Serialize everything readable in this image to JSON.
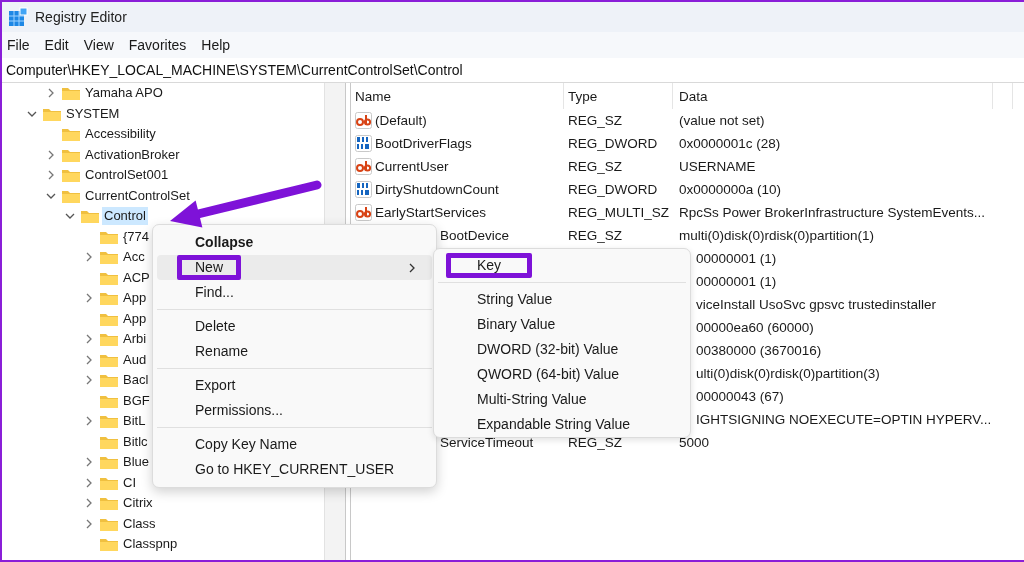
{
  "window": {
    "title": "Registry Editor"
  },
  "menu_bar": [
    "File",
    "Edit",
    "View",
    "Favorites",
    "Help"
  ],
  "address_bar": {
    "value": "Computer\\HKEY_LOCAL_MACHINE\\SYSTEM\\CurrentControlSet\\Control"
  },
  "tree": {
    "tail_of_previous_key": [
      {
        "label": "Yamaha APO",
        "expanded": false,
        "selected": false
      }
    ],
    "keys": [
      {
        "label": "SYSTEM",
        "expanded": true,
        "selected": false,
        "children": [
          {
            "label": "Accessibility",
            "selected": false
          },
          {
            "label": "ActivationBroker",
            "expanded": false,
            "selected": false
          },
          {
            "label": "ControlSet001",
            "expanded": false,
            "selected": false
          },
          {
            "label": "CurrentControlSet",
            "expanded": true,
            "selected": false,
            "children": [
              {
                "label": "Control",
                "expanded": true,
                "selected": true,
                "children": [
                  {
                    "label": "{774",
                    "selected": false
                  },
                  {
                    "label": "Acc",
                    "expanded": false,
                    "selected": false
                  },
                  {
                    "label": "ACP",
                    "selected": false
                  },
                  {
                    "label": "App",
                    "expanded": false,
                    "selected": false
                  },
                  {
                    "label": "App",
                    "selected": false
                  },
                  {
                    "label": "Arbi",
                    "expanded": false,
                    "selected": false
                  },
                  {
                    "label": "Aud",
                    "expanded": false,
                    "selected": false
                  },
                  {
                    "label": "Bacl",
                    "expanded": false,
                    "selected": false
                  },
                  {
                    "label": "BGF",
                    "selected": false
                  },
                  {
                    "label": "BitL",
                    "expanded": false,
                    "selected": false
                  },
                  {
                    "label": "Bitlc",
                    "selected": false
                  },
                  {
                    "label": "Blue",
                    "expanded": false,
                    "selected": false
                  },
                  {
                    "label": "CI",
                    "expanded": false,
                    "selected": false
                  },
                  {
                    "label": "Citrix",
                    "expanded": false,
                    "selected": false
                  },
                  {
                    "label": "Class",
                    "expanded": false,
                    "selected": false
                  },
                  {
                    "label": "Classpnp",
                    "selected": false
                  }
                ]
              }
            ]
          }
        ]
      }
    ]
  },
  "values": {
    "columns": [
      "Name",
      "Type",
      "Data"
    ],
    "rows": [
      {
        "kind": "string",
        "name": "(Default)",
        "type": "REG_SZ",
        "data": "(value not set)"
      },
      {
        "kind": "binary",
        "name": "BootDriverFlags",
        "type": "REG_DWORD",
        "data": "0x0000001c (28)"
      },
      {
        "kind": "string",
        "name": "CurrentUser",
        "type": "REG_SZ",
        "data": "USERNAME"
      },
      {
        "kind": "binary",
        "name": "DirtyShutdownCount",
        "type": "REG_DWORD",
        "data": "0x0000000a (10)"
      },
      {
        "kind": "string",
        "name": "EarlyStartServices",
        "type": "REG_MULTI_SZ",
        "data": "RpcSs Power BrokerInfrastructure SystemEvents..."
      },
      {
        "name": "BootDevice",
        "name_cut": true,
        "type": "REG_SZ",
        "data": "multi(0)disk(0)rdisk(0)partition(1)"
      },
      {
        "data": "00000001 (1)",
        "data_cut": true
      },
      {
        "data": "00000001 (1)",
        "data_cut": true
      },
      {
        "data": "viceInstall UsoSvc gpsvc trustedinstaller",
        "data_cut": true
      },
      {
        "data": "00000ea60 (60000)",
        "data_cut": true
      },
      {
        "data": "00380000 (3670016)",
        "data_cut": true
      },
      {
        "data": "ulti(0)disk(0)rdisk(0)partition(3)",
        "data_cut": true
      },
      {
        "data": "00000043 (67)",
        "data_cut": true
      },
      {
        "data": "IGHTSIGNING  NOEXECUTE=OPTIN  HYPERV...",
        "data_cut": true
      },
      {
        "name": "ServiceTimeout",
        "name_cut": true,
        "type": "REG_SZ",
        "data": "5000"
      }
    ]
  },
  "context_menu": {
    "groups": [
      [
        {
          "label": "Collapse",
          "default": true,
          "highlighted": false,
          "annotated": false,
          "submenu": false
        },
        {
          "label": "New",
          "default": false,
          "highlighted": true,
          "annotated": true,
          "submenu": true
        },
        {
          "label": "Find...",
          "default": false,
          "highlighted": false,
          "annotated": false,
          "submenu": false
        }
      ],
      [
        {
          "label": "Delete",
          "default": false,
          "highlighted": false,
          "annotated": false,
          "submenu": false
        },
        {
          "label": "Rename",
          "default": false,
          "highlighted": false,
          "annotated": false,
          "submenu": false
        }
      ],
      [
        {
          "label": "Export",
          "default": false,
          "highlighted": false,
          "annotated": false,
          "submenu": false
        },
        {
          "label": "Permissions...",
          "default": false,
          "highlighted": false,
          "annotated": false,
          "submenu": false
        }
      ],
      [
        {
          "label": "Copy Key Name",
          "default": false,
          "highlighted": false,
          "annotated": false,
          "submenu": false
        },
        {
          "label": "Go to HKEY_CURRENT_USER",
          "default": false,
          "highlighted": false,
          "annotated": false,
          "submenu": false
        }
      ]
    ]
  },
  "submenu": {
    "groups": [
      [
        {
          "label": "Key",
          "annotated": true
        }
      ],
      [
        {
          "label": "String Value",
          "annotated": false
        },
        {
          "label": "Binary Value",
          "annotated": false
        },
        {
          "label": "DWORD (32-bit) Value",
          "annotated": false
        },
        {
          "label": "QWORD (64-bit) Value",
          "annotated": false
        },
        {
          "label": "Multi-String Value",
          "annotated": false
        },
        {
          "label": "Expandable String Value",
          "annotated": false
        }
      ]
    ]
  },
  "pointer_arrow": true
}
